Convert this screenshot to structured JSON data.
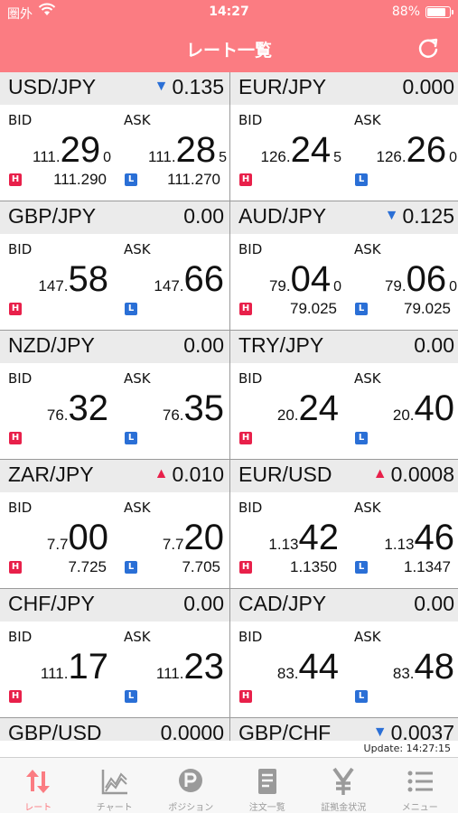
{
  "status": {
    "carrier": "圏外",
    "time": "14:27",
    "battery": "88%",
    "battery_level": 0.88
  },
  "header": {
    "title": "レート一覧"
  },
  "labels": {
    "bid": "BID",
    "ask": "ASK",
    "high": "H",
    "low": "L"
  },
  "colors": {
    "accent": "#fb7c82",
    "down": "#2a6fd6",
    "up": "#e8204a"
  },
  "pairs": [
    {
      "pair": "USD/JPY",
      "dir": "down",
      "change": "0.135",
      "bid": {
        "pre": "111.",
        "big": "29",
        "pip": "0"
      },
      "ask": {
        "pre": "111.",
        "big": "28",
        "pip": "5"
      },
      "high": "111.290",
      "low": "111.270"
    },
    {
      "pair": "EUR/JPY",
      "dir": "",
      "change": "0.000",
      "bid": {
        "pre": "126.",
        "big": "24",
        "pip": "5"
      },
      "ask": {
        "pre": "126.",
        "big": "26",
        "pip": "0"
      },
      "high": "",
      "low": ""
    },
    {
      "pair": "GBP/JPY",
      "dir": "",
      "change": "0.00",
      "bid": {
        "pre": "147.",
        "big": "58",
        "pip": ""
      },
      "ask": {
        "pre": "147.",
        "big": "66",
        "pip": ""
      },
      "high": "",
      "low": ""
    },
    {
      "pair": "AUD/JPY",
      "dir": "down",
      "change": "0.125",
      "bid": {
        "pre": "79.",
        "big": "04",
        "pip": "0"
      },
      "ask": {
        "pre": "79.",
        "big": "06",
        "pip": "0"
      },
      "high": "79.025",
      "low": "79.025"
    },
    {
      "pair": "NZD/JPY",
      "dir": "",
      "change": "0.00",
      "bid": {
        "pre": "76.",
        "big": "32",
        "pip": ""
      },
      "ask": {
        "pre": "76.",
        "big": "35",
        "pip": ""
      },
      "high": "",
      "low": ""
    },
    {
      "pair": "TRY/JPY",
      "dir": "",
      "change": "0.00",
      "bid": {
        "pre": "20.",
        "big": "24",
        "pip": ""
      },
      "ask": {
        "pre": "20.",
        "big": "40",
        "pip": ""
      },
      "high": "",
      "low": ""
    },
    {
      "pair": "ZAR/JPY",
      "dir": "up",
      "change": "0.010",
      "bid": {
        "pre": "7.7",
        "big": "00",
        "pip": ""
      },
      "ask": {
        "pre": "7.7",
        "big": "20",
        "pip": ""
      },
      "high": "7.725",
      "low": "7.705"
    },
    {
      "pair": "EUR/USD",
      "dir": "up",
      "change": "0.0008",
      "bid": {
        "pre": "1.13",
        "big": "42",
        "pip": ""
      },
      "ask": {
        "pre": "1.13",
        "big": "46",
        "pip": ""
      },
      "high": "1.1350",
      "low": "1.1347"
    },
    {
      "pair": "CHF/JPY",
      "dir": "",
      "change": "0.00",
      "bid": {
        "pre": "111.",
        "big": "17",
        "pip": ""
      },
      "ask": {
        "pre": "111.",
        "big": "23",
        "pip": ""
      },
      "high": "",
      "low": ""
    },
    {
      "pair": "CAD/JPY",
      "dir": "",
      "change": "0.00",
      "bid": {
        "pre": "83.",
        "big": "44",
        "pip": ""
      },
      "ask": {
        "pre": "83.",
        "big": "48",
        "pip": ""
      },
      "high": "",
      "low": ""
    },
    {
      "pair": "GBP/USD",
      "dir": "",
      "change": "0.0000",
      "bid": {
        "pre": "",
        "big": "",
        "pip": ""
      },
      "ask": {
        "pre": "",
        "big": "",
        "pip": ""
      },
      "high": "",
      "low": ""
    },
    {
      "pair": "GBP/CHF",
      "dir": "down",
      "change": "0.0037",
      "bid": {
        "pre": "",
        "big": "",
        "pip": ""
      },
      "ask": {
        "pre": "",
        "big": "",
        "pip": ""
      },
      "high": "",
      "low": ""
    }
  ],
  "update": {
    "text": "Update: 14:27:15"
  },
  "tabs": [
    {
      "label": "レート",
      "icon": "rate-arrows-icon",
      "active": true
    },
    {
      "label": "チャート",
      "icon": "chart-icon",
      "active": false
    },
    {
      "label": "ポジション",
      "icon": "position-p-icon",
      "active": false
    },
    {
      "label": "注文一覧",
      "icon": "order-list-icon",
      "active": false
    },
    {
      "label": "証拠金状況",
      "icon": "yen-icon",
      "active": false
    },
    {
      "label": "メニュー",
      "icon": "menu-list-icon",
      "active": false
    }
  ]
}
